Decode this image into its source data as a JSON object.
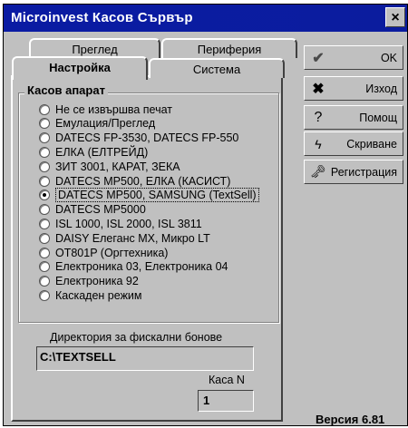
{
  "window": {
    "title": "Microinvest Касов Сървър",
    "close": "×"
  },
  "tabs": {
    "back_row": [
      "Преглед",
      "Периферия"
    ],
    "front_row": [
      "Настройка",
      "Система"
    ]
  },
  "group": {
    "label": "Касов апарат",
    "options": [
      "Не се извършва печат",
      "Емулация/Преглед",
      "DATECS FP-3530, DATECS FP-550",
      "ЕЛКА (ЕЛТРЕЙД)",
      "ЗИТ 3001, КАРАТ, ЗЕКА",
      "DATECS MP500, ЕЛКА (КАСИСТ)",
      "DATECS MP500, SAMSUNG (TextSell)",
      "DATECS MP5000",
      "ISL 1000, ISL 2000, ISL 3811",
      "DAISY Елеганс MX, Микро LT",
      "OT801P (Оргтехника)",
      "Електроника 03, Електроника 04",
      "Електроника 92",
      "Каскаден режим"
    ],
    "selected_index": 6
  },
  "fiscal_dir": {
    "label": "Директория за фискални бонове",
    "value": "C:\\TEXTSELL"
  },
  "kasa": {
    "label": "Каса N",
    "value": "1"
  },
  "buttons": {
    "ok": "OK",
    "exit": "Изход",
    "help": "Помощ",
    "hide": "Скриване",
    "register": "Регистрация"
  },
  "icons": {
    "ok": "check-icon",
    "exit": "x-icon",
    "help": "question-icon",
    "hide": "lightning-icon",
    "register": "keys-icon"
  },
  "version": "Версия 6.81"
}
